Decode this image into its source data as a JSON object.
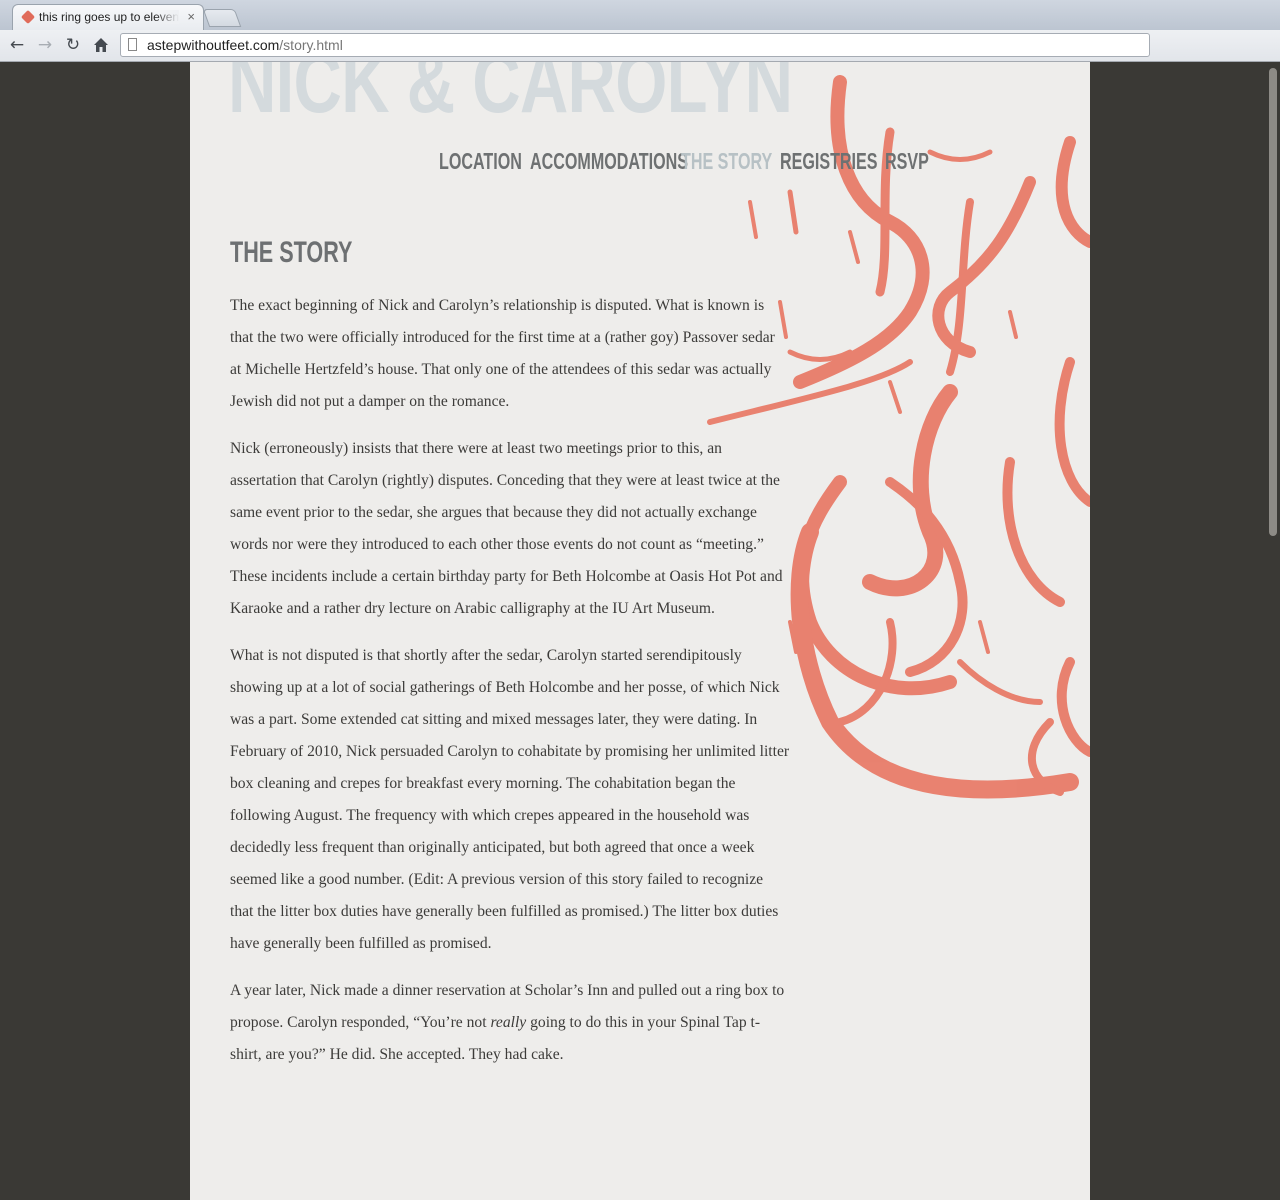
{
  "browser": {
    "tab_title": "this ring goes up to eleven",
    "tab_close": "×",
    "url_host": "astepwithoutfeet.com",
    "url_path": "/story.html",
    "back_icon": "back-arrow-icon",
    "forward_icon": "forward-arrow-icon",
    "reload_icon": "reload-icon",
    "home_icon": "home-icon"
  },
  "site": {
    "title": "NICK & CAROLYN",
    "accent_color": "#e8735f"
  },
  "nav": {
    "items": [
      {
        "label": "LOCATION"
      },
      {
        "label": "ACCOMMODATIONS"
      },
      {
        "label": "THE STORY",
        "active": true
      },
      {
        "label": "REGISTRIES"
      },
      {
        "label": "RSVP"
      }
    ]
  },
  "story": {
    "heading": "THE STORY",
    "p1": "The exact beginning of Nick and Carolyn’s relationship is disputed. What is known is that the two were officially introduced for the first time at a (rather goy) Passover sedar at Michelle Hertzfeld’s house. That only one of the attendees of this sedar was actually Jewish did not put a damper on the romance.",
    "p2": "Nick (erroneously) insists that there were at least two meetings prior to this, an assertation that Carolyn (rightly) disputes. Conceding that they were at least twice at the same event prior to the sedar, she argues that because they did not actually exchange words nor were they introduced to each other those events do not count as “meeting.” These incidents include a certain birthday party for Beth Holcombe at Oasis Hot Pot and Karaoke and a rather dry lecture on Arabic calligraphy at the IU Art Museum.",
    "p3": "What is not disputed is that shortly after the sedar, Carolyn started serendipitously showing up at a lot of social gatherings of Beth Holcombe and her posse, of which Nick was a part. Some extended cat sitting and mixed messages later, they were dating. In February of 2010, Nick persuaded Carolyn to cohabitate by promising her unlimited litter box cleaning and crepes for breakfast every morning. The cohabitation began the following August. The frequency with which crepes appeared in the household was decidedly less frequent than originally anticipated, but both agreed that once a week seemed like a good number. (Edit: A previous version of this story failed to recognize that the litter box duties have generally been fulfilled as promised.) The litter box duties have generally been fulfilled as promised.",
    "p4_before": "A year later, Nick made a dinner reservation at Scholar’s Inn and pulled out a ring box to propose. Carolyn responded, “You’re not ",
    "p4_em": "really",
    "p4_after": " going to do this in your Spinal Tap t-shirt, are you?” He did. She accepted. They had cake."
  }
}
